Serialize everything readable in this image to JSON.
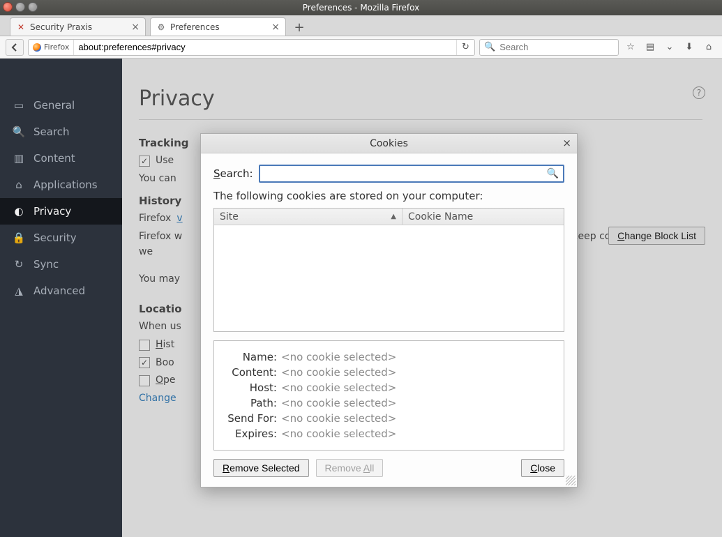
{
  "window": {
    "title": "Preferences - Mozilla Firefox"
  },
  "tabs": [
    {
      "label": "Security Praxis"
    },
    {
      "label": "Preferences"
    }
  ],
  "identity_label": "Firefox",
  "url": "about:preferences#privacy",
  "search_placeholder": "Search",
  "sidebar": {
    "items": [
      {
        "label": "General"
      },
      {
        "label": "Search"
      },
      {
        "label": "Content"
      },
      {
        "label": "Applications"
      },
      {
        "label": "Privacy"
      },
      {
        "label": "Security"
      },
      {
        "label": "Sync"
      },
      {
        "label": "Advanced"
      }
    ]
  },
  "page": {
    "title": "Privacy",
    "tracking_heading": "Tracking",
    "tracking_use": "Use",
    "change_block_prefix": "C",
    "change_block_rest": "hange Block List",
    "you_can": "You can",
    "history_heading": "History",
    "firefox_v": "Firefox ",
    "firefox_v_link": "v",
    "firefox_w_line": "Firefox w",
    "firefox_w_tail": "and keep cookies from we",
    "you_may": "You may",
    "location_heading": "Locatio",
    "when_us": "When us",
    "hist_chk": "H",
    "hist_chk_rest": "ist",
    "book_chk": "Boo",
    "open_chk": "O",
    "open_chk_rest": "pe",
    "change_link": "Change"
  },
  "modal": {
    "title": "Cookies",
    "search_label_key": "S",
    "search_label_rest": "earch:",
    "description": "The following cookies are stored on your computer:",
    "col_site": "Site",
    "col_name": "Cookie Name",
    "detail_labels": {
      "name": "Name:",
      "content": "Content:",
      "host": "Host:",
      "path": "Path:",
      "sendfor": "Send For:",
      "expires": "Expires:"
    },
    "no_cookie": "<no cookie selected>",
    "remove_selected_key": "R",
    "remove_selected_rest": "emove Selected",
    "remove_all_pre": "Remove ",
    "remove_all_key": "A",
    "remove_all_rest": "ll",
    "close_key": "C",
    "close_rest": "lose"
  }
}
